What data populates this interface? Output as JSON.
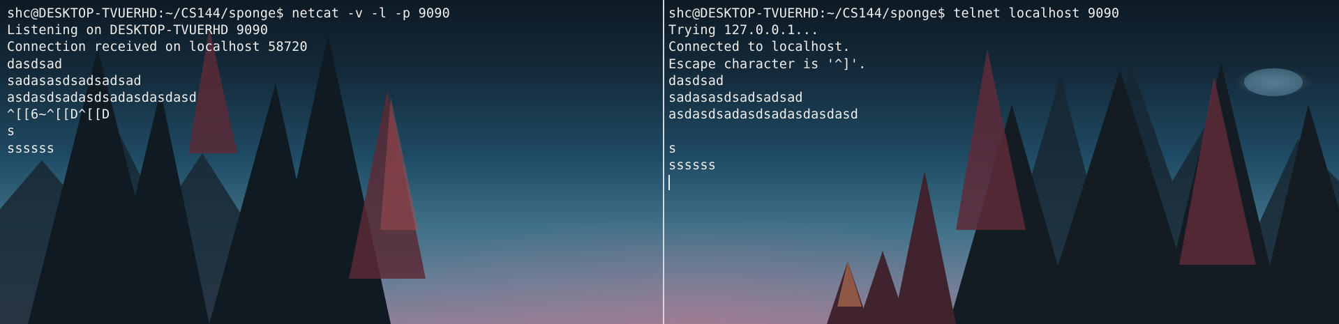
{
  "left_pane": {
    "lines": [
      "shc@DESKTOP-TVUERHD:~/CS144/sponge$ netcat -v -l -p 9090",
      "Listening on DESKTOP-TVUERHD 9090",
      "Connection received on localhost 58720",
      "dasdsad",
      "sadasasdsadsadsad",
      "asdasdsadasdsadasdasdasd",
      "^[[6~^[[D^[[D",
      "s",
      "ssssss"
    ]
  },
  "right_pane": {
    "lines": [
      "shc@DESKTOP-TVUERHD:~/CS144/sponge$ telnet localhost 9090",
      "Trying 127.0.0.1...",
      "Connected to localhost.",
      "Escape character is '^]'.",
      "dasdsad",
      "sadasasdsadsadsad",
      "asdasdsadasdsadasdasdasd",
      "",
      "s",
      "ssssss"
    ]
  },
  "colors": {
    "text": "#f0f0f0",
    "divider": "#d8d8d8",
    "sky_top": "#0d1a24",
    "sky_bottom": "#8d7f97"
  }
}
